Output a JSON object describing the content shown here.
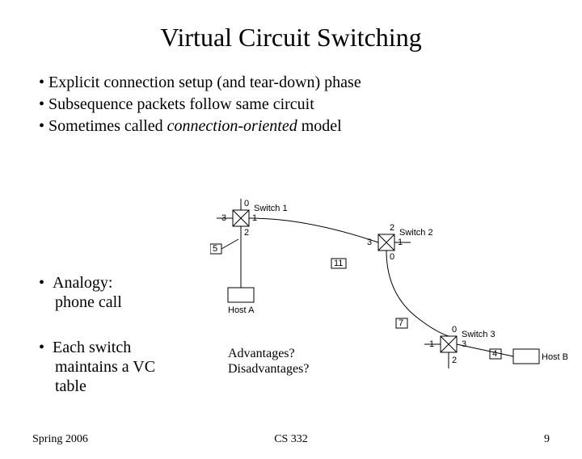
{
  "title": "Virtual Circuit Switching",
  "bullets": {
    "b1": "Explicit connection setup (and tear-down) phase",
    "b2": "Subsequence packets follow same circuit",
    "b3_pre": "Sometimes called ",
    "b3_italic": "connection-oriented",
    "b3_post": " model"
  },
  "lower": {
    "l1a": "Analogy:",
    "l1b": "phone call",
    "l2a": "Each switch",
    "l2b": "maintains a VC",
    "l2c": "table"
  },
  "diagram": {
    "switch1": "Switch 1",
    "switch2": "Switch 2",
    "switch3": "Switch 3",
    "hostA": "Host A",
    "hostB": "Host B",
    "sw1_p0": "0",
    "sw1_p1": "1",
    "sw1_p2": "2",
    "sw1_p3": "3",
    "sw2_p0": "0",
    "sw2_p1": "1",
    "sw2_p2": "2",
    "sw2_p3": "3",
    "sw3_p0": "0",
    "sw3_p1": "1",
    "sw3_p2": "2",
    "sw3_p3": "3",
    "vci5": "5",
    "vci11": "11",
    "vci7": "7",
    "vci4": "4"
  },
  "adv": {
    "q1": "Advantages?",
    "q2": "Disadvantages?"
  },
  "footer": {
    "left": "Spring 2006",
    "center": "CS 332",
    "right": "9"
  }
}
